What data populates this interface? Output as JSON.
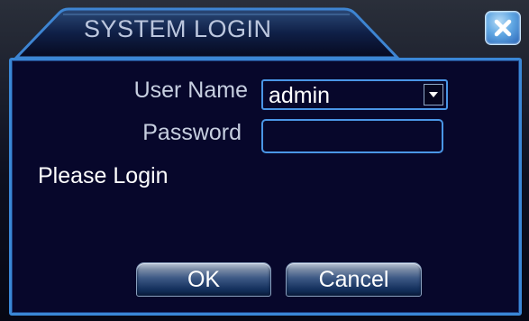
{
  "dialog": {
    "title": "SYSTEM LOGIN",
    "close_icon": "close-x-icon"
  },
  "form": {
    "username_label": "User Name",
    "username_value": "admin",
    "username_dropdown_icon": "chevron-down-icon",
    "password_label": "Password",
    "password_value": "",
    "status_text": "Please Login"
  },
  "buttons": {
    "ok_label": "OK",
    "cancel_label": "Cancel"
  },
  "colors": {
    "accent_border": "#3a87d6",
    "panel_background": "#07072b",
    "title_text": "#bcc7de",
    "label_text": "#c7cfe0",
    "close_button": "#5fa6e2"
  }
}
